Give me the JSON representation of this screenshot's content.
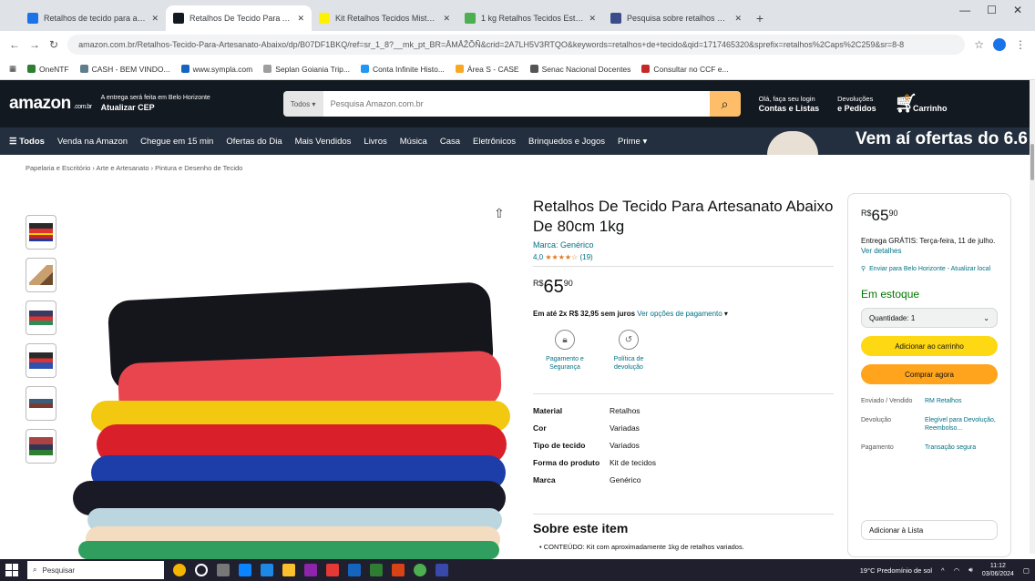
{
  "browser": {
    "tabs": [
      {
        "title": "Retalhos de tecido para arte...",
        "color": "#1a73e8",
        "active": false
      },
      {
        "title": "Retalhos De Tecido Para Artesa...",
        "color": "#131921",
        "active": true
      },
      {
        "title": "Kit Retalhos Tecidos Mistos...",
        "color": "#fff200",
        "active": false
      },
      {
        "title": "1 kg Retalhos Tecidos Estampa...",
        "color": "#4caf50",
        "active": false
      },
      {
        "title": "Pesquisa sobre retalhos de...",
        "color": "#3c4b8b",
        "active": false
      }
    ],
    "new_tab": "+",
    "url": "amazon.com.br/Retalhos-Tecido-Para-Artesanato-Abaixo/dp/B07DF1BKQ/ref=sr_1_8?__mk_pt_BR=ÅMÅŽÕÑ&crid=2A7LH5V3RTQO&keywords=retalhos+de+tecido&qid=1717465320&sprefix=retalhos%2Caps%2C259&sr=8-8",
    "bookmarks": [
      {
        "label": "OneNTF",
        "color": "#2e7d32"
      },
      {
        "label": "CASH - BEM VINDO...",
        "color": "#607d8b"
      },
      {
        "label": "www.sympla.com",
        "color": "#1565c0"
      },
      {
        "label": "Seplan Goiania Trip...",
        "color": "#9e9e9e"
      },
      {
        "label": "Conta Infinite Histo...",
        "color": "#2196f3"
      },
      {
        "label": "Área S - CASE",
        "color": "#f9a825"
      },
      {
        "label": "Senac Nacional Docentes",
        "color": "#555555"
      },
      {
        "label": "Consultar no CCF e...",
        "color": "#c62828"
      }
    ]
  },
  "amazon": {
    "logo": "amazon",
    "logo_suffix": ".com.br",
    "deliver_line1": "A entrega será feita em Belo Horizonte",
    "deliver_line2": "Atualizar CEP",
    "search_category": "Todos",
    "search_placeholder": "Pesquisa Amazon.com.br",
    "account_line1": "Olá, faça seu login",
    "account_line2": "Contas e Listas",
    "orders_line1": "Devoluções",
    "orders_line2": "e Pedidos",
    "cart_count": "0",
    "cart_label": "Carrinho",
    "nav": [
      "☰ Todos",
      "Venda na Amazon",
      "Chegue em 15 min",
      "Ofertas do Dia",
      "Mais Vendidos",
      "Livros",
      "Música",
      "Casa",
      "Eletrônicos",
      "Brinquedos e Jogos",
      "Prime ▾"
    ],
    "promo": "Vem aí ofertas do 6.6",
    "breadcrumb": "Papelaria e Escritório › Arte e Artesanato › Pintura e Desenho de Tecido"
  },
  "product": {
    "title": "Retalhos De Tecido Para Artesanato Abaixo De 80cm 1kg",
    "brand": "Marca: Genérico",
    "rating_value": "4,0",
    "rating_stars": "★★★★☆",
    "rating_count": "(19)",
    "price_currency": "R$",
    "price_int": "65",
    "price_cents": "90",
    "installment_bold": "Em até 2x R$ 32,95 sem juros",
    "installment_link": "Ver opções de pagamento",
    "features": [
      "Pagamento e Segurança",
      "Política de devolução"
    ],
    "specs": [
      {
        "k": "Material",
        "v": "Retalhos"
      },
      {
        "k": "Cor",
        "v": "Variadas"
      },
      {
        "k": "Tipo de tecido",
        "v": "Variados"
      },
      {
        "k": "Forma do produto",
        "v": "Kit de tecidos"
      },
      {
        "k": "Marca",
        "v": "Genérico"
      }
    ],
    "about_title": "Sobre este item",
    "about_bullet": "• CONTEÚDO: Kit com aproximadamente 1kg de retalhos variados."
  },
  "buybox": {
    "price_currency": "R$",
    "price_int": "65",
    "price_cents": "90",
    "delivery_text": "Entrega GRÁTIS: Terça-feira, 11 de julho.",
    "delivery_link": "Ver detalhes",
    "location": "Enviar para Belo Horizonte - Atualizar local",
    "stock": "Em estoque",
    "quantity": "Quantidade: 1",
    "add_to_cart": "Adicionar ao carrinho",
    "buy_now": "Comprar agora",
    "info": [
      {
        "k": "Enviado / Vendido",
        "v": "RM Retalhos"
      },
      {
        "k": "Devolução",
        "v": "Elegível para Devolução, Reembolso..."
      },
      {
        "k": "Pagamento",
        "v": "Transação segura"
      }
    ],
    "add_to_list": "Adicionar à Lista"
  },
  "taskbar": {
    "search": "Pesquisar",
    "weather": "19°C Predomínio de sol",
    "time": "11:12",
    "date": "03/06/2024"
  }
}
